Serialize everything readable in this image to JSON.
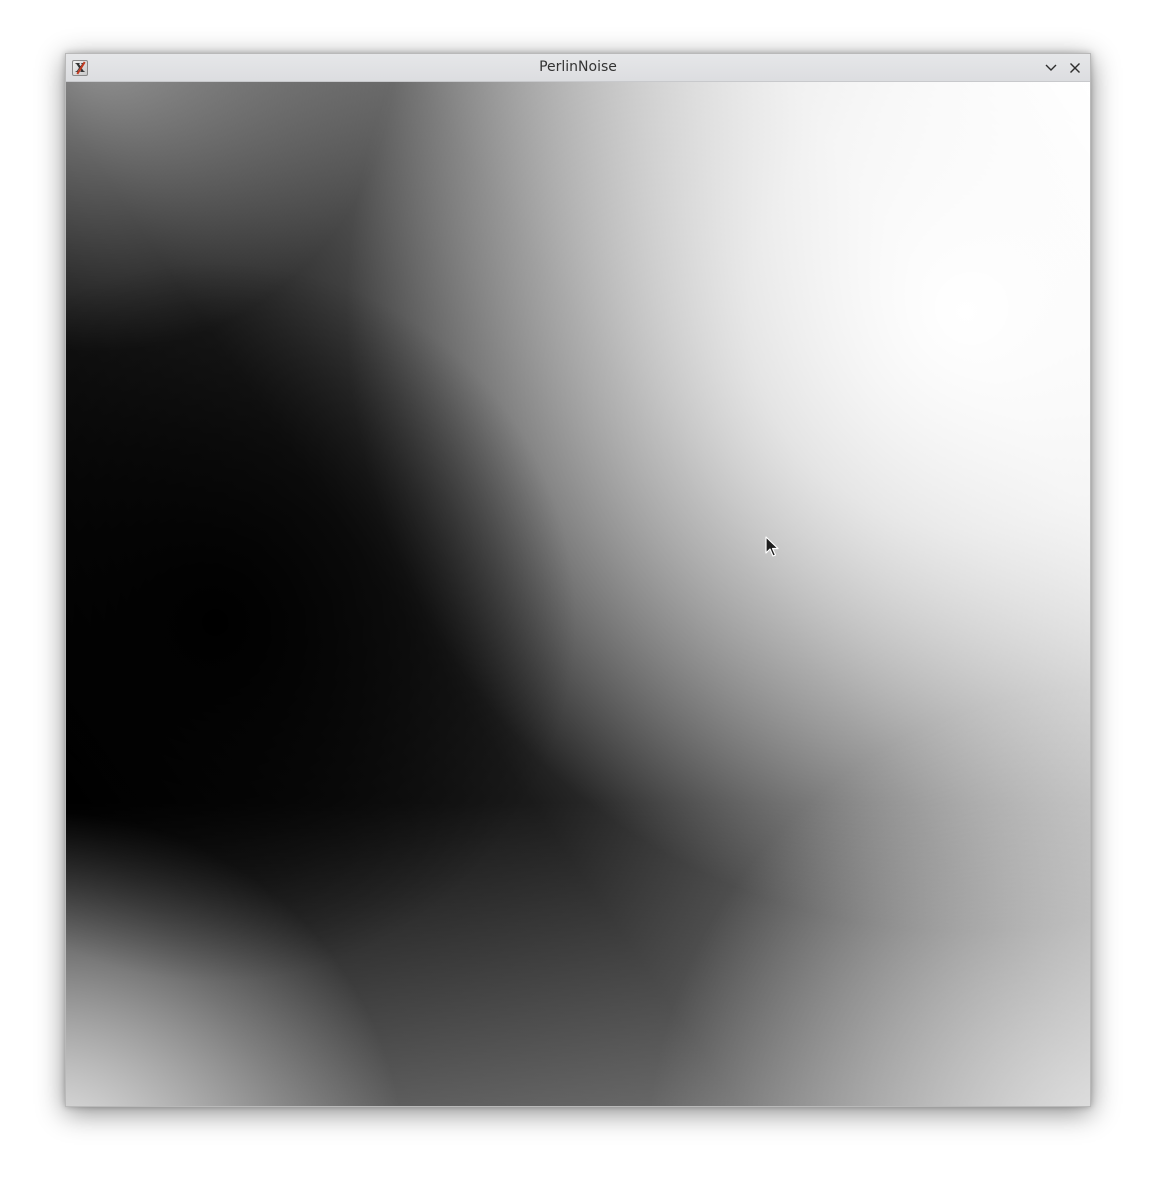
{
  "window": {
    "title": "PerlinNoise",
    "icon": "x-app-icon",
    "icon_glyph": "X",
    "controls": {
      "minimize_icon": "chevron-down-icon",
      "close_icon": "close-icon"
    }
  },
  "canvas": {
    "content": "perlin-noise-grayscale",
    "colors": {
      "darkest": "#000000",
      "lightest": "#ffffff",
      "titlebar": "#e0e1e3"
    }
  },
  "cursor": {
    "icon": "arrow-pointer-icon"
  }
}
